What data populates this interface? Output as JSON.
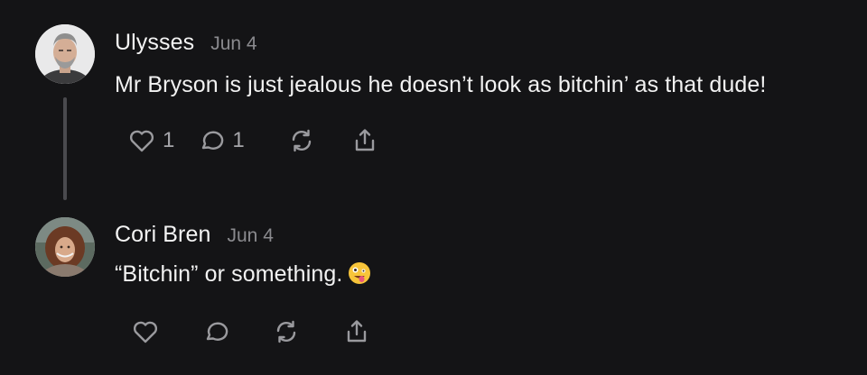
{
  "comments": [
    {
      "author": "Ulysses",
      "date": "Jun 4",
      "text": "Mr Bryson is just jealous he doesn’t look as bitchin’ as that dude!",
      "likes": "1",
      "replies": "1",
      "icons": [
        "heart-icon",
        "speech-bubble-icon",
        "restack-icon",
        "share-icon"
      ]
    },
    {
      "author": "Cori Bren",
      "date": "Jun 4",
      "text": "“Bitchin” or something.",
      "emoji": "zany-face-emoji",
      "icons": [
        "heart-icon",
        "speech-bubble-icon",
        "restack-icon",
        "share-icon"
      ]
    }
  ],
  "colors": {
    "background": "#141416",
    "text": "#f2f2f2",
    "muted": "#8a8a8e",
    "icon": "#9a9a9e",
    "thread_line": "#4a4a4e"
  }
}
